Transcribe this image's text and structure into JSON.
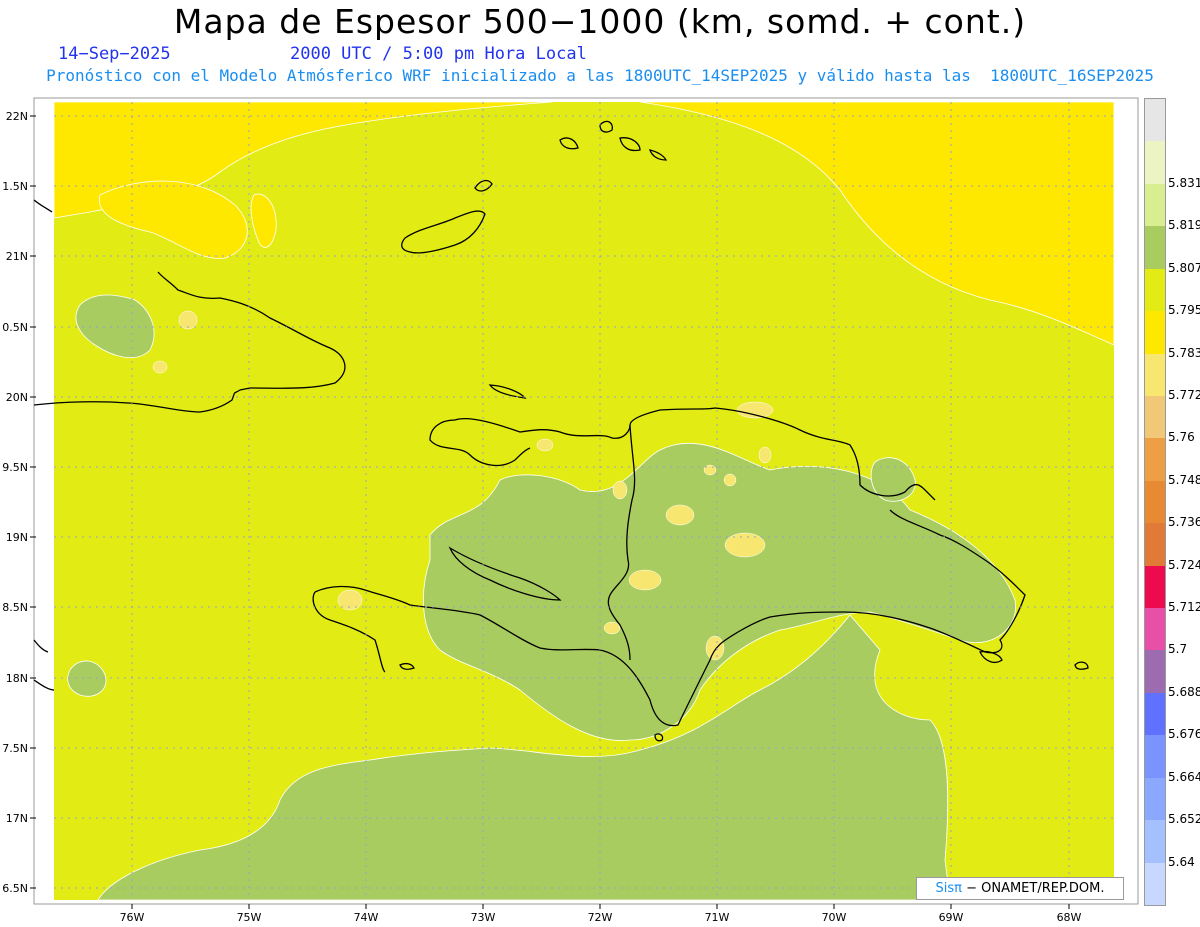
{
  "title": "Mapa de Espesor 500−1000 (km, somd. + cont.)",
  "date": "14−Sep−2025",
  "time": "2000 UTC / 5:00 pm Hora Local",
  "description": "Pronóstico con el Modelo Atmósferico WRF inicializado a las 1800UTC_14SEP2025 y válido hasta las  1800UTC_16SEP2025",
  "axes": {
    "lat_labels": [
      "22N",
      "1.5N",
      "21N",
      "0.5N",
      "20N",
      "9.5N",
      "19N",
      "8.5N",
      "18N",
      "7.5N",
      "17N",
      "6.5N"
    ],
    "lon_labels": [
      "76W",
      "75W",
      "74W",
      "73W",
      "72W",
      "71W",
      "70W",
      "69W",
      "68W"
    ]
  },
  "legend": {
    "levels": [
      "5.64",
      "5.652",
      "5.664",
      "5.676",
      "5.688",
      "5.7",
      "5.712",
      "5.724",
      "5.736",
      "5.748",
      "5.76",
      "5.772",
      "5.783",
      "5.795",
      "5.807",
      "5.819",
      "5.831"
    ],
    "colors": [
      "#c8d7ff",
      "#a4c0ff",
      "#8ba8ff",
      "#7a94ff",
      "#6070ff",
      "#9c6bb0",
      "#e850a8",
      "#ee0a4e",
      "#e07a36",
      "#e88a34",
      "#ee9e44",
      "#f0c878",
      "#f7e770",
      "#ffe800",
      "#e2ec14",
      "#a9cc60",
      "#d8ee90",
      "#ecf4c4",
      "#e6e6e6"
    ],
    "series": [
      "Espesor 500−1000"
    ]
  },
  "map_colors": {
    "background": "#e2ec14",
    "high": "#ffe800",
    "low": "#a9cc60",
    "spots": "#f7e770",
    "coast": "#000000"
  },
  "credit": {
    "brand": "Sisπ",
    "text": " − ONAMET/REP.DOM."
  }
}
